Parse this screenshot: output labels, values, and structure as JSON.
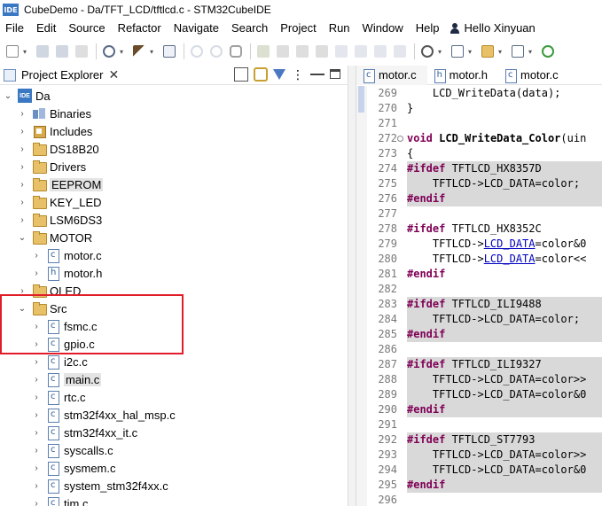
{
  "window": {
    "title": "CubeDemo - Da/TFT_LCD/tftlcd.c - STM32CubeIDE",
    "logo": "IDE"
  },
  "menu": [
    "File",
    "Edit",
    "Source",
    "Refactor",
    "Navigate",
    "Search",
    "Project",
    "Run",
    "Window",
    "Help"
  ],
  "user": {
    "label": "Hello Xinyuan"
  },
  "explorer": {
    "title": "Project Explorer",
    "close": "✕",
    "rows": [
      {
        "label": "Da",
        "icon": "project",
        "twisty": "expanded",
        "indent": 0
      },
      {
        "label": "Binaries",
        "icon": "binaries",
        "twisty": "collapsed",
        "indent": 1
      },
      {
        "label": "Includes",
        "icon": "includes",
        "twisty": "collapsed",
        "indent": 1
      },
      {
        "label": "DS18B20",
        "icon": "folder",
        "twisty": "collapsed",
        "indent": 1
      },
      {
        "label": "Drivers",
        "icon": "folder",
        "twisty": "collapsed",
        "indent": 1
      },
      {
        "label": "EEPROM",
        "icon": "folder",
        "twisty": "collapsed",
        "indent": 1,
        "selected": true
      },
      {
        "label": "KEY_LED",
        "icon": "folder",
        "twisty": "collapsed",
        "indent": 1
      },
      {
        "label": "LSM6DS3",
        "icon": "folder",
        "twisty": "collapsed",
        "indent": 1
      },
      {
        "label": "MOTOR",
        "icon": "folder",
        "twisty": "expanded",
        "indent": 1
      },
      {
        "label": "motor.c",
        "icon": "c-file",
        "twisty": "collapsed",
        "indent": 2
      },
      {
        "label": "motor.h",
        "icon": "h-file",
        "twisty": "collapsed",
        "indent": 2
      },
      {
        "label": "OLED",
        "icon": "folder",
        "twisty": "collapsed",
        "indent": 1
      },
      {
        "label": "Src",
        "icon": "folder",
        "twisty": "expanded",
        "indent": 1
      },
      {
        "label": "fsmc.c",
        "icon": "c-file",
        "twisty": "collapsed",
        "indent": 2
      },
      {
        "label": "gpio.c",
        "icon": "c-file",
        "twisty": "collapsed",
        "indent": 2
      },
      {
        "label": "i2c.c",
        "icon": "c-file",
        "twisty": "collapsed",
        "indent": 2
      },
      {
        "label": "main.c",
        "icon": "c-file",
        "twisty": "collapsed",
        "indent": 2,
        "selected": true
      },
      {
        "label": "rtc.c",
        "icon": "c-file",
        "twisty": "collapsed",
        "indent": 2
      },
      {
        "label": "stm32f4xx_hal_msp.c",
        "icon": "c-file",
        "twisty": "collapsed",
        "indent": 2
      },
      {
        "label": "stm32f4xx_it.c",
        "icon": "c-file",
        "twisty": "collapsed",
        "indent": 2
      },
      {
        "label": "syscalls.c",
        "icon": "c-file",
        "twisty": "collapsed",
        "indent": 2
      },
      {
        "label": "sysmem.c",
        "icon": "c-file",
        "twisty": "collapsed",
        "indent": 2
      },
      {
        "label": "system_stm32f4xx.c",
        "icon": "c-file",
        "twisty": "collapsed",
        "indent": 2
      },
      {
        "label": "tim.c",
        "icon": "c-file",
        "twisty": "collapsed",
        "indent": 2
      }
    ]
  },
  "editor": {
    "tabs": [
      {
        "label": "motor.c",
        "icon": "c-file",
        "active": true
      },
      {
        "label": "motor.h",
        "icon": "h-file",
        "active": false
      },
      {
        "label": "motor.c",
        "icon": "c-file",
        "active": false
      }
    ],
    "lines": [
      {
        "n": "269",
        "text": "    LCD_WriteData(data);",
        "kind": "normal"
      },
      {
        "n": "270",
        "text": "}",
        "kind": "normal"
      },
      {
        "n": "271",
        "text": "",
        "kind": "normal"
      },
      {
        "n": "272",
        "text": "void LCD_WriteData_Color(uin",
        "kind": "decl",
        "fold": true
      },
      {
        "n": "273",
        "text": "{",
        "kind": "normal"
      },
      {
        "n": "274",
        "text": "#ifdef TFTLCD_HX8357D",
        "kind": "pre",
        "shade": true
      },
      {
        "n": "275",
        "text": "    TFTLCD->LCD_DATA=color;",
        "kind": "shaded",
        "shade": true
      },
      {
        "n": "276",
        "text": "#endif",
        "kind": "pre",
        "shade": true
      },
      {
        "n": "277",
        "text": "",
        "kind": "normal"
      },
      {
        "n": "278",
        "text": "#ifdef TFTLCD_HX8352C",
        "kind": "pre"
      },
      {
        "n": "279",
        "text": "    TFTLCD->LCD_DATA=color&0",
        "kind": "field"
      },
      {
        "n": "280",
        "text": "    TFTLCD->LCD_DATA=color<<",
        "kind": "field"
      },
      {
        "n": "281",
        "text": "#endif",
        "kind": "pre"
      },
      {
        "n": "282",
        "text": "",
        "kind": "normal"
      },
      {
        "n": "283",
        "text": "#ifdef TFTLCD_ILI9488",
        "kind": "pre",
        "shade": true
      },
      {
        "n": "284",
        "text": "    TFTLCD->LCD_DATA=color;",
        "kind": "shaded",
        "shade": true
      },
      {
        "n": "285",
        "text": "#endif",
        "kind": "pre",
        "shade": true
      },
      {
        "n": "286",
        "text": "",
        "kind": "normal"
      },
      {
        "n": "287",
        "text": "#ifdef TFTLCD_ILI9327",
        "kind": "pre",
        "shade": true
      },
      {
        "n": "288",
        "text": "    TFTLCD->LCD_DATA=color>>",
        "kind": "shaded",
        "shade": true
      },
      {
        "n": "289",
        "text": "    TFTLCD->LCD_DATA=color&0",
        "kind": "shaded",
        "shade": true
      },
      {
        "n": "290",
        "text": "#endif",
        "kind": "pre",
        "shade": true
      },
      {
        "n": "291",
        "text": "",
        "kind": "normal"
      },
      {
        "n": "292",
        "text": "#ifdef TFTLCD_ST7793",
        "kind": "pre",
        "shade": true
      },
      {
        "n": "293",
        "text": "    TFTLCD->LCD_DATA=color>>",
        "kind": "shaded",
        "shade": true
      },
      {
        "n": "294",
        "text": "    TFTLCD->LCD_DATA=color&0",
        "kind": "shaded",
        "shade": true
      },
      {
        "n": "295",
        "text": "#endif",
        "kind": "pre",
        "shade": true
      },
      {
        "n": "296",
        "text": "",
        "kind": "normal"
      }
    ]
  },
  "colors": {
    "highlight": "#e11d2a",
    "accent": "#3b78c4",
    "preproc": "#7f0055",
    "field": "#0000c0"
  }
}
